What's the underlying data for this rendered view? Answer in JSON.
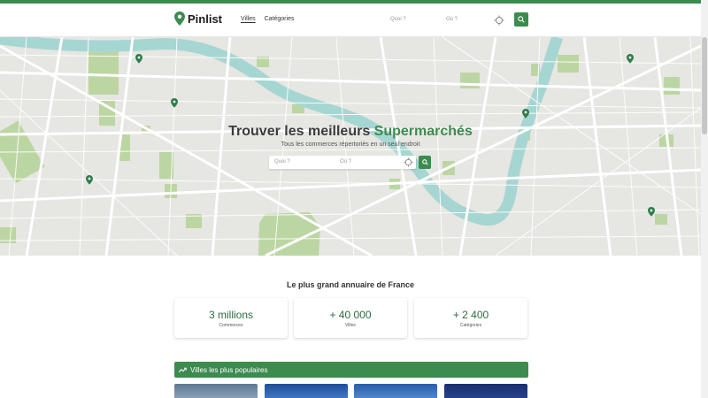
{
  "header": {
    "logo": "Pinlist",
    "nav": [
      "Villes",
      "Catégories"
    ],
    "search_what": "Quoi ?",
    "search_where": "Où ?"
  },
  "hero": {
    "title_prefix": "Trouver les meilleurs",
    "title_accent": "Supermarchés",
    "subtitle": "Tous les commerces répertoriés en un seul endroit",
    "search_what": "Quoi ?",
    "search_where": "Où ?"
  },
  "stats": {
    "title": "Le plus grand annuaire de France",
    "items": [
      {
        "value": "3 millions",
        "label": "Commerces"
      },
      {
        "value": "+ 40 000",
        "label": "Villes"
      },
      {
        "value": "+ 2 400",
        "label": "Catégories"
      }
    ]
  },
  "popular": {
    "title": "Villes les plus populaires"
  },
  "colors": {
    "brand": "#3c8b4f",
    "river": "#a6d6d2",
    "park": "#bcd6a3",
    "map_bg": "#e6e6e2"
  },
  "icons": [
    "map-pin-icon",
    "location-target-icon",
    "search-icon",
    "trending-up-icon"
  ]
}
